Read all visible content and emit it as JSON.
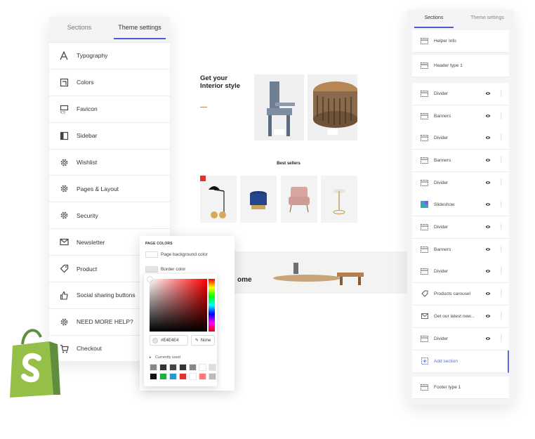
{
  "left_panel": {
    "tabs": [
      "Sections",
      "Theme settings"
    ],
    "active_tab": 1,
    "items": [
      {
        "label": "Typography",
        "icon": "typography-icon"
      },
      {
        "label": "Colors",
        "icon": "colors-icon"
      },
      {
        "label": "Favicon",
        "icon": "favicon-icon"
      },
      {
        "label": "Sidebar",
        "icon": "sidebar-icon"
      },
      {
        "label": "Wishlist",
        "icon": "gear-icon"
      },
      {
        "label": "Pages & Layout",
        "icon": "gear-icon"
      },
      {
        "label": "Security",
        "icon": "gear-icon"
      },
      {
        "label": "Newsletter",
        "icon": "mail-icon"
      },
      {
        "label": "Product",
        "icon": "tag-icon"
      },
      {
        "label": "Social sharing buttons",
        "icon": "thumbs-up-icon"
      },
      {
        "label": "NEED MORE HELP?",
        "icon": "gear-icon"
      },
      {
        "label": "Checkout",
        "icon": "cart-icon"
      }
    ]
  },
  "preview": {
    "hero_title": "Get your Interior style",
    "best_sellers_title": "Best sellers",
    "band_text": "ome"
  },
  "color_popup": {
    "title": "PAGE COLORS",
    "rows": [
      "Page background color",
      "Border color"
    ],
    "hex_value": "#E4E4E4",
    "none_label": "None",
    "currently_used_label": "Currently used",
    "swatches": [
      "#888888",
      "#333333",
      "#444444",
      "#333333",
      "#888888",
      "#ffffff",
      "#dddddd",
      "#111111",
      "#22aa44",
      "#2299cc",
      "#dd3333",
      "#ffffff",
      "#ff7777",
      "#bbbbbb"
    ]
  },
  "right_panel": {
    "tabs": [
      "Sections",
      "Theme settings"
    ],
    "active_tab": 0,
    "items": [
      {
        "label": "Helper Info",
        "eye": false
      },
      {
        "label": "Header type 1",
        "eye": false
      },
      {
        "label": "Divider",
        "eye": true
      },
      {
        "label": "Banners",
        "eye": true
      },
      {
        "label": "Divider",
        "eye": true
      },
      {
        "label": "Banners",
        "eye": true
      },
      {
        "label": "Divider",
        "eye": true
      },
      {
        "label": "Slideshow",
        "eye": true
      },
      {
        "label": "Divider",
        "eye": true
      },
      {
        "label": "Banners",
        "eye": true
      },
      {
        "label": "Divider",
        "eye": true
      },
      {
        "label": "Products carousel",
        "eye": true
      },
      {
        "label": "Get our latest new...",
        "eye": true
      },
      {
        "label": "Divider",
        "eye": true
      },
      {
        "label": "Add section",
        "eye": false
      },
      {
        "label": "Footer type 1",
        "eye": false
      }
    ]
  }
}
